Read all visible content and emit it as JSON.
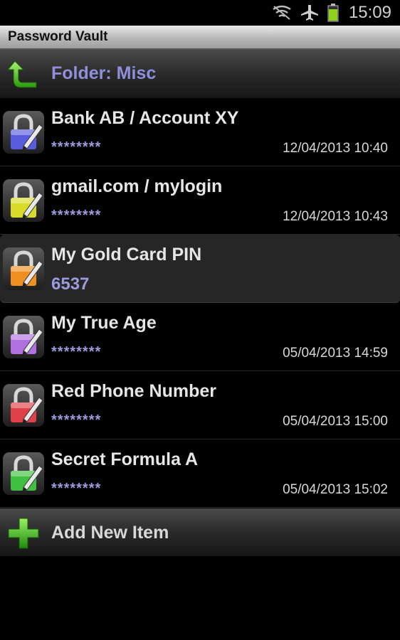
{
  "status_bar": {
    "time": "15:09",
    "icons": [
      "wifi-off-icon",
      "airplane-icon",
      "battery-icon"
    ],
    "battery_color": "#8fd11c"
  },
  "app": {
    "title": "Password Vault"
  },
  "folder": {
    "label": "Folder: Misc",
    "icon": "back-arrow-icon"
  },
  "items": [
    {
      "title": "Bank AB / Account XY",
      "secret": "********",
      "date": "12/04/2013 10:40",
      "lock_color": "#5a5ce0"
    },
    {
      "title": "gmail.com / mylogin",
      "secret": "********",
      "date": "12/04/2013 10:43",
      "lock_color": "#d8dc28"
    },
    {
      "title": "My Gold Card PIN",
      "secret": "6537",
      "date": "",
      "lock_color": "#f09020"
    },
    {
      "title": "My True Age",
      "secret": "********",
      "date": "05/04/2013 14:59",
      "lock_color": "#b070e0"
    },
    {
      "title": "Red Phone Number",
      "secret": "********",
      "date": "05/04/2013 15:00",
      "lock_color": "#e04048"
    },
    {
      "title": "Secret Formula A",
      "secret": "********",
      "date": "05/04/2013 15:02",
      "lock_color": "#40c040"
    }
  ],
  "add_item": {
    "label": "Add New Item",
    "icon": "plus-icon"
  },
  "colors": {
    "accent": "#9b9bde",
    "background": "#000000"
  }
}
